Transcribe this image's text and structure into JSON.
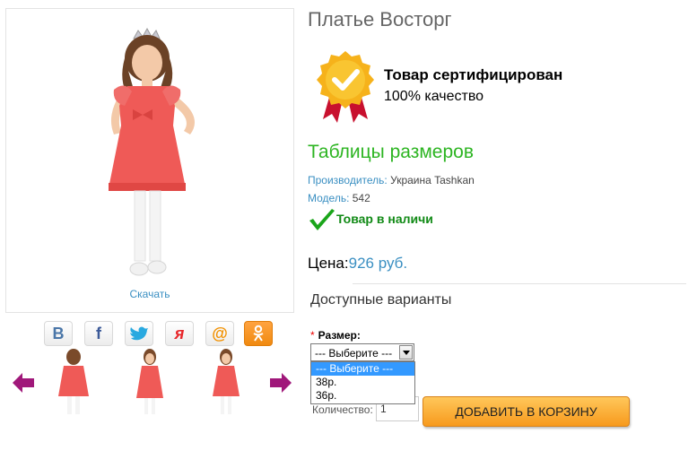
{
  "product": {
    "title": "Платье Восторг",
    "download_label": "Скачать"
  },
  "certificate": {
    "title": "Товар сертифицирован",
    "subtitle": "100% качество"
  },
  "size_table_link": "Таблицы размеров",
  "info": {
    "manufacturer_key": "Производитель:",
    "manufacturer_value": "Украина Tashkan",
    "model_key": "Модель:",
    "model_value": "542"
  },
  "stock_status": "Товар в наличи",
  "price": {
    "label": "Цена:",
    "value": "926 руб."
  },
  "variants_heading": "Доступные варианты",
  "size": {
    "required_mark": "*",
    "label": "Размер:",
    "selected": "--- Выберите ---",
    "options": [
      "--- Выберите ---",
      "38р.",
      "36р."
    ]
  },
  "quantity": {
    "label": "Количество:",
    "value": "1"
  },
  "add_to_cart_label": "ДОБАВИТЬ В КОРЗИНУ",
  "share": {
    "vk": "B",
    "facebook": "f",
    "twitter": "twitter",
    "odnoklassniki_alt": "я",
    "mail": "@",
    "ok": "ok"
  },
  "colors": {
    "dress": "#ef5a57",
    "accent_link": "#3a8fc2",
    "green": "#2db522",
    "arrow": "#a0187a",
    "button": "#f7a22b"
  }
}
